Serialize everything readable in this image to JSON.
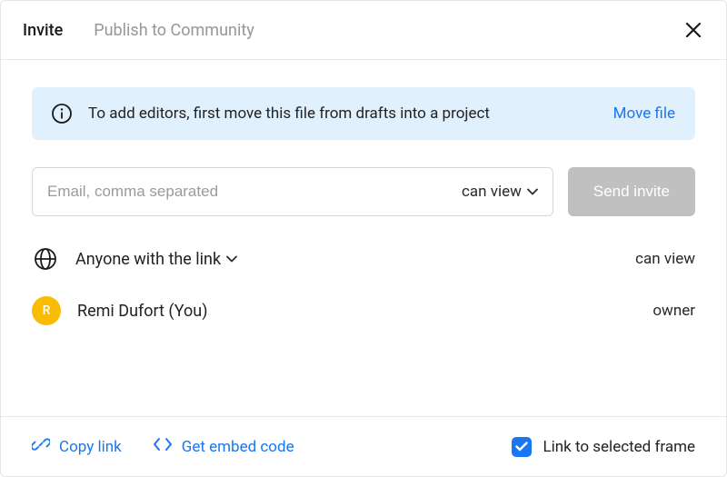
{
  "header": {
    "tabs": {
      "invite": "Invite",
      "publish": "Publish to Community"
    }
  },
  "banner": {
    "text": "To add editors, first move this file from drafts into a project",
    "action": "Move file"
  },
  "invite": {
    "email_placeholder": "Email, comma separated",
    "permission": "can view",
    "send_label": "Send invite"
  },
  "access": {
    "link": {
      "label": "Anyone with the link",
      "role": "can view"
    },
    "owner": {
      "initial": "R",
      "name": "Remi Dufort (You)",
      "role": "owner"
    }
  },
  "footer": {
    "copy_link": "Copy link",
    "embed_code": "Get embed code",
    "checkbox_label": "Link to selected frame",
    "checkbox_checked": true
  }
}
